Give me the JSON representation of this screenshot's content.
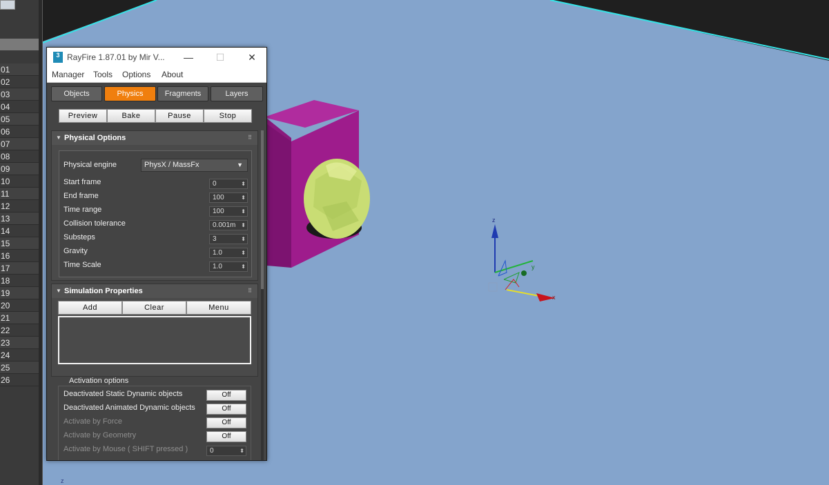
{
  "timeline": {
    "numbers": [
      "01",
      "02",
      "03",
      "04",
      "05",
      "06",
      "07",
      "08",
      "09",
      "10",
      "11",
      "12",
      "13",
      "14",
      "15",
      "16",
      "17",
      "18",
      "19",
      "20",
      "21",
      "22",
      "23",
      "24",
      "25",
      "26"
    ]
  },
  "viewport": {
    "gizmo_labels": {
      "z": "z",
      "y": "y",
      "x": "x"
    },
    "corner_label": "z",
    "colors": {
      "background": "#84a4cc",
      "box": "#9e1c8c",
      "shell": "#c9dd74",
      "grid_edge": "#36e2e6"
    }
  },
  "window": {
    "title": "RayFire 1.87.01  by Mir V...",
    "app_icon": "3",
    "controls": {
      "minimize": "—",
      "maximize": "☐",
      "close": "✕"
    },
    "menu": [
      "Manager",
      "Tools",
      "Options",
      "About"
    ],
    "tabs": [
      {
        "label": "Objects",
        "active": false
      },
      {
        "label": "Physics",
        "active": true
      },
      {
        "label": "Fragments",
        "active": false
      },
      {
        "label": "Layers",
        "active": false
      }
    ],
    "actions": [
      "Preview",
      "Bake",
      "Pause",
      "Stop"
    ],
    "physical_options": {
      "title": "Physical Options",
      "engine_label": "Physical engine",
      "engine_value": "PhysX / MassFx",
      "params": [
        {
          "label": "Start frame",
          "value": "0"
        },
        {
          "label": "End frame",
          "value": "100"
        },
        {
          "label": "Time range",
          "value": "100"
        },
        {
          "label": "Collision tolerance",
          "value": "0.001m"
        },
        {
          "label": "Substeps",
          "value": "3"
        },
        {
          "label": "Gravity",
          "value": "1.0"
        },
        {
          "label": "Time Scale",
          "value": "1.0"
        }
      ]
    },
    "simulation_properties": {
      "title": "Simulation Properties",
      "buttons": [
        "Add",
        "Clear",
        "Menu"
      ]
    },
    "activation_options": {
      "title": "Activation options",
      "rows": [
        {
          "label": "Deactivated Static Dynamic objects",
          "value": "Off",
          "enabled": true,
          "kind": "button"
        },
        {
          "label": "Deactivated Animated Dynamic objects",
          "value": "Off",
          "enabled": true,
          "kind": "button"
        },
        {
          "label": "Activate by Force",
          "value": "Off",
          "enabled": false,
          "kind": "button"
        },
        {
          "label": "Activate by Geometry",
          "value": "Off",
          "enabled": false,
          "kind": "button"
        },
        {
          "label": "Activate by Mouse ( SHIFT pressed )",
          "value": "0",
          "enabled": false,
          "kind": "spinner"
        }
      ]
    },
    "accent": "#f07f0e"
  }
}
